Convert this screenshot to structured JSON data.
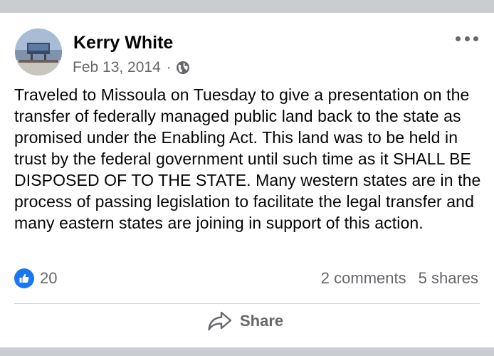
{
  "post": {
    "author": "Kerry White",
    "date": "Feb 13, 2014",
    "separator": "·",
    "body": "Traveled to Missoula on Tuesday to give a presentation on the transfer of federally managed public land back to the state as promised under the Enabling Act. This land was to be held in trust by the federal government until such time as it SHALL BE DISPOSED OF TO THE STATE. Many western states are in the process of passing legislation to facilitate the legal transfer and many eastern states are joining in support of this action.",
    "reaction_count": "20",
    "comments": "2 comments",
    "shares": "5 shares",
    "share_label": "Share",
    "icons": {
      "privacy": "globe-icon",
      "more": "more-options-icon",
      "reaction": "like-icon",
      "share": "share-icon"
    }
  },
  "colors": {
    "accent": "#1877f2",
    "text": "#050505",
    "muted": "#65676b",
    "background": "#c9ccd1",
    "card": "#ffffff"
  }
}
